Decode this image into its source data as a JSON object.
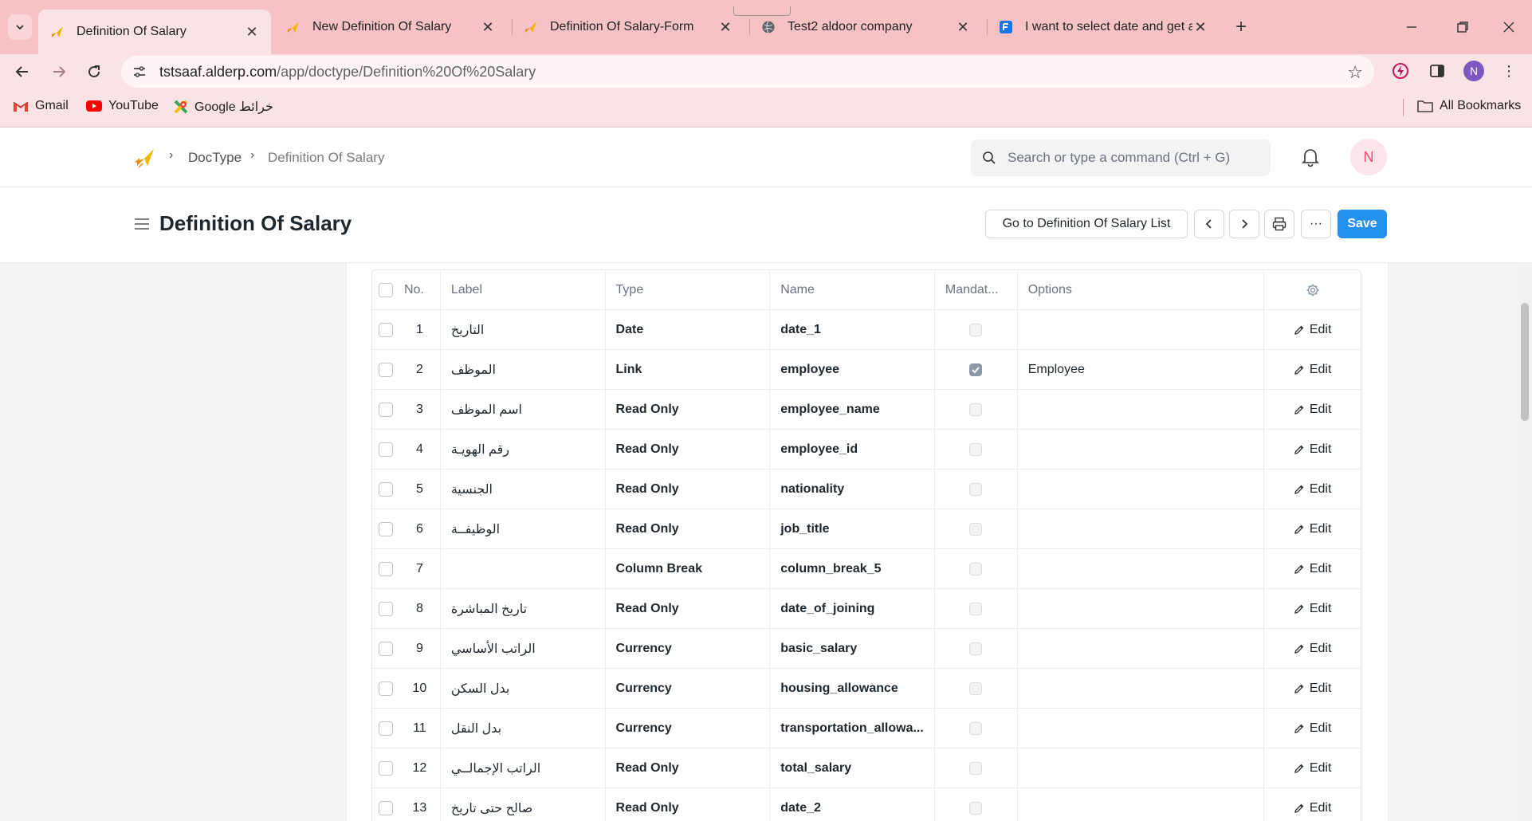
{
  "browser": {
    "tabs": [
      {
        "title": "Definition Of Salary",
        "icon": "frappe-rocket-icon",
        "active": true
      },
      {
        "title": "New Definition Of Salary",
        "icon": "frappe-rocket-icon",
        "active": false
      },
      {
        "title": "Definition Of Salary-Form",
        "icon": "frappe-rocket-icon",
        "active": false
      },
      {
        "title": "Test2 aldoor company",
        "icon": "globe-icon",
        "active": false
      },
      {
        "title": "I want to select date and get an",
        "icon": "forum-icon",
        "active": false
      }
    ],
    "url_host": "tstsaaf.alderp.com",
    "url_path": "/app/doctype/Definition%20Of%20Salary",
    "profile_initial": "N",
    "bookmarks": [
      {
        "label": "Gmail",
        "icon": "gmail-icon"
      },
      {
        "label": "YouTube",
        "icon": "youtube-icon"
      },
      {
        "label": "Google خرائط",
        "icon": "maps-icon"
      }
    ],
    "all_bookmarks_label": "All Bookmarks"
  },
  "navbar": {
    "breadcrumbs": [
      "DocType",
      "Definition Of Salary"
    ],
    "search_placeholder": "Search or type a command (Ctrl + G)",
    "user_initial": "N"
  },
  "page": {
    "title": "Definition Of Salary",
    "go_to_list_label": "Go to Definition Of Salary List",
    "more_label": "···",
    "save_label": "Save"
  },
  "table": {
    "headers": {
      "no": "No.",
      "label": "Label",
      "type": "Type",
      "name": "Name",
      "mandatory": "Mandat...",
      "options": "Options"
    },
    "edit_label": "Edit",
    "rows": [
      {
        "no": "1",
        "label": "التاريخ",
        "type": "Date",
        "name": "date_1",
        "mandatory": false,
        "options": ""
      },
      {
        "no": "2",
        "label": "الموظف",
        "type": "Link",
        "name": "employee",
        "mandatory": true,
        "options": "Employee"
      },
      {
        "no": "3",
        "label": "اسم الموظف",
        "type": "Read Only",
        "name": "employee_name",
        "mandatory": false,
        "options": ""
      },
      {
        "no": "4",
        "label": "رقم الهويـة",
        "type": "Read Only",
        "name": "employee_id",
        "mandatory": false,
        "options": ""
      },
      {
        "no": "5",
        "label": "الجنسية",
        "type": "Read Only",
        "name": "nationality",
        "mandatory": false,
        "options": ""
      },
      {
        "no": "6",
        "label": "الوظيفــة",
        "type": "Read Only",
        "name": "job_title",
        "mandatory": false,
        "options": ""
      },
      {
        "no": "7",
        "label": "",
        "type": "Column Break",
        "name": "column_break_5",
        "mandatory": false,
        "options": ""
      },
      {
        "no": "8",
        "label": "تاريخ المباشرة",
        "type": "Read Only",
        "name": "date_of_joining",
        "mandatory": false,
        "options": ""
      },
      {
        "no": "9",
        "label": "الراتب الأساسي",
        "type": "Currency",
        "name": "basic_salary",
        "mandatory": false,
        "options": ""
      },
      {
        "no": "10",
        "label": "بدل السكن",
        "type": "Currency",
        "name": "housing_allowance",
        "mandatory": false,
        "options": ""
      },
      {
        "no": "11",
        "label": "بدل النقل",
        "type": "Currency",
        "name": "transportation_allowa...",
        "mandatory": false,
        "options": ""
      },
      {
        "no": "12",
        "label": "الراتب الإجمالــي",
        "type": "Read Only",
        "name": "total_salary",
        "mandatory": false,
        "options": ""
      },
      {
        "no": "13",
        "label": "صالح حتى تاريخ",
        "type": "Read Only",
        "name": "date_2",
        "mandatory": false,
        "options": ""
      }
    ]
  }
}
